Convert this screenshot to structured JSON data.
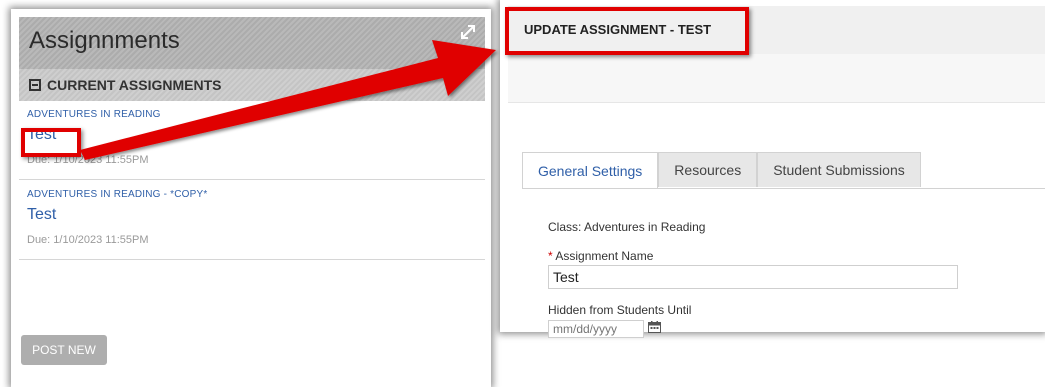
{
  "left_panel": {
    "title": "Assignnments",
    "section_title": "CURRENT ASSIGNMENTS",
    "assignments": [
      {
        "class": "ADVENTURES IN READING",
        "name": "Test",
        "due": "Due: 1/10/2023 11:55PM"
      },
      {
        "class": "ADVENTURES IN READING - *COPY*",
        "name": "Test",
        "due": "Due: 1/10/2023 11:55PM"
      }
    ],
    "post_new_label": "POST NEW"
  },
  "right_panel": {
    "title": "UPDATE ASSIGNMENT - TEST",
    "tabs": [
      {
        "label": "General Settings",
        "active": true
      },
      {
        "label": "Resources",
        "active": false
      },
      {
        "label": "Student Submissions",
        "active": false
      }
    ],
    "class_line": "Class: Adventures in Reading",
    "required_mark": "*",
    "assignment_name_label": "Assignment Name",
    "assignment_name_value": "Test",
    "hidden_until_label": "Hidden from Students Until",
    "hidden_until_placeholder": "mm/dd/yyyy"
  },
  "icons": {
    "expand": "expand-icon",
    "collapse": "minus-square-icon",
    "calendar": "calendar-icon"
  },
  "colors": {
    "annotation_red": "#e00000",
    "link_blue": "#2f5fa8"
  }
}
